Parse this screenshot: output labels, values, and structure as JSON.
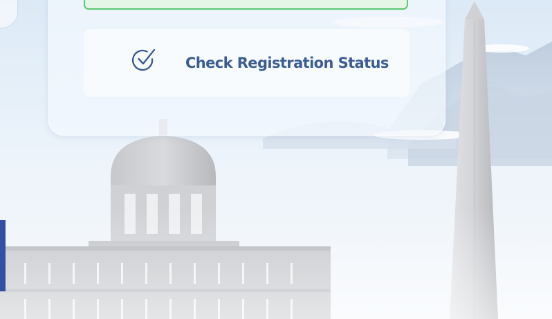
{
  "status_card": {
    "check_button": {
      "label": "Check Registration Status",
      "icon": "check-circle-icon"
    },
    "confirm_box": {
      "state": "success",
      "color": "#5cc86f"
    }
  },
  "colors": {
    "accent_text": "#3c5d93",
    "success_border": "#5cc86f",
    "side_strip": "#3350a5"
  }
}
